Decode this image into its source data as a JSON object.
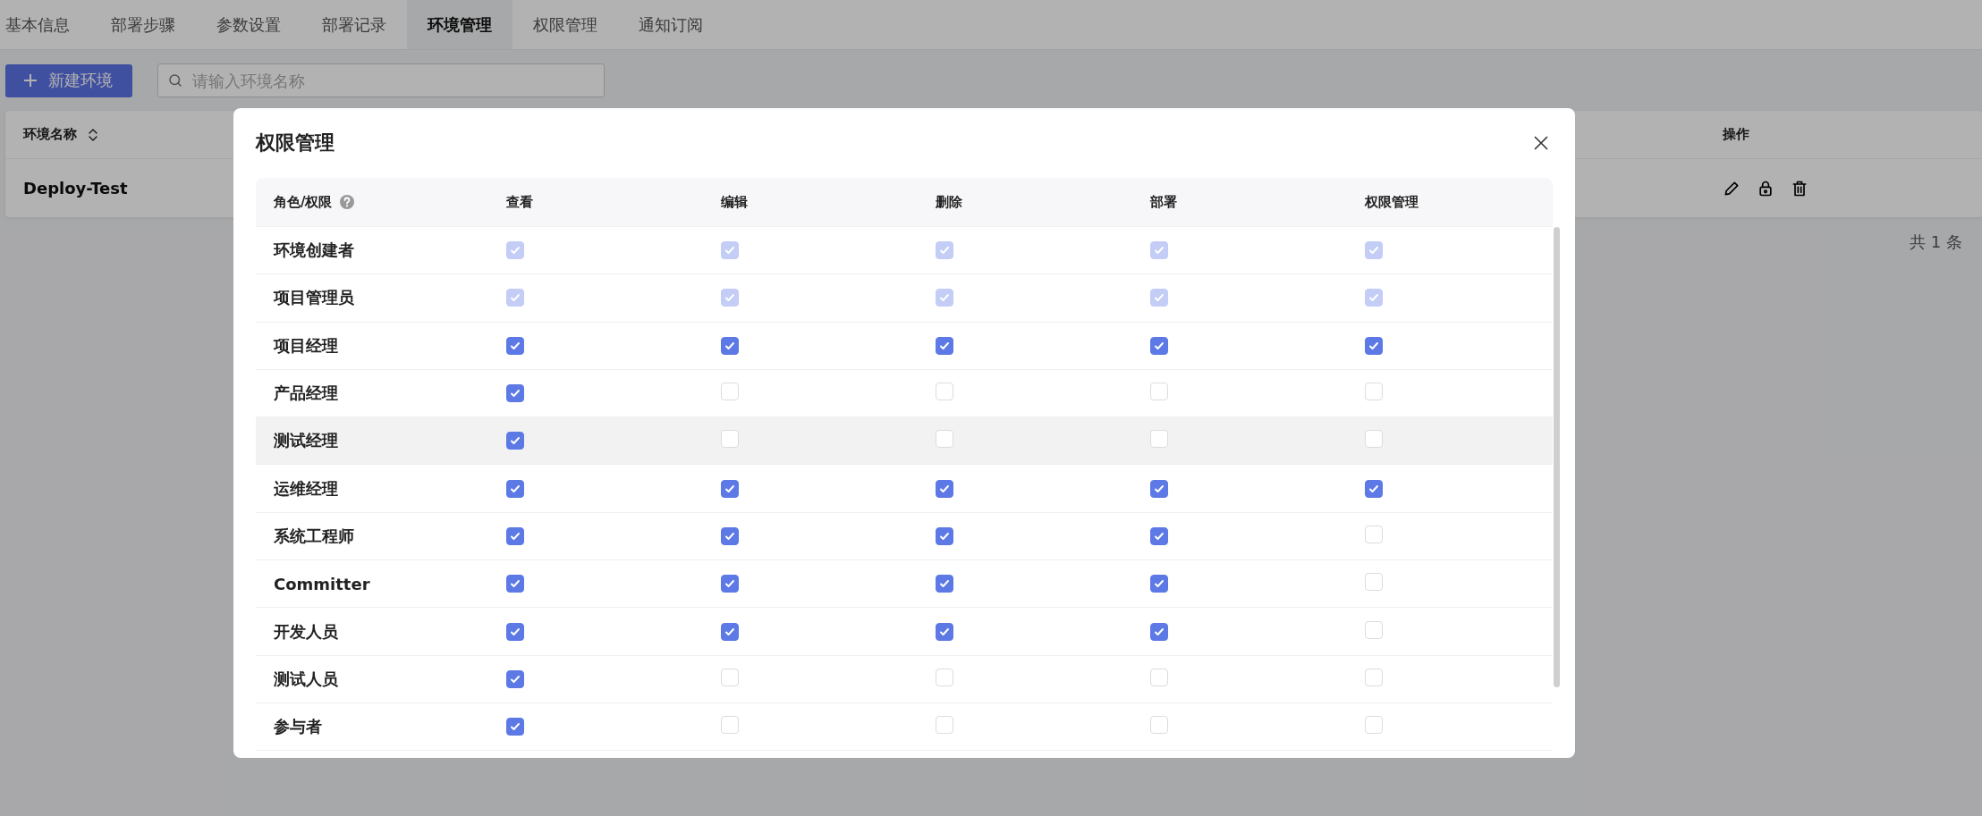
{
  "tabs": [
    {
      "label": "基本信息",
      "selected": false
    },
    {
      "label": "部署步骤",
      "selected": false
    },
    {
      "label": "参数设置",
      "selected": false
    },
    {
      "label": "部署记录",
      "selected": false
    },
    {
      "label": "环境管理",
      "selected": true
    },
    {
      "label": "权限管理",
      "selected": false
    },
    {
      "label": "通知订阅",
      "selected": false
    }
  ],
  "toolbar": {
    "new_button": "新建环境",
    "search": {
      "placeholder": "请输入环境名称"
    }
  },
  "table": {
    "columns": [
      {
        "label": "环境名称",
        "sortable": true
      },
      {
        "label": "操作",
        "sortable": false
      }
    ],
    "rows": [
      {
        "name": "Deploy-Test"
      }
    ]
  },
  "pagination": {
    "total": "共 1 条"
  },
  "dialog": {
    "title": "权限管理",
    "columns": [
      "角色/权限",
      "查看",
      "编辑",
      "删除",
      "部署",
      "权限管理"
    ],
    "rows": [
      {
        "role": "环境创建者",
        "disabled": true,
        "highlighted": false,
        "checks": [
          true,
          true,
          true,
          true,
          true
        ]
      },
      {
        "role": "项目管理员",
        "disabled": true,
        "highlighted": false,
        "checks": [
          true,
          true,
          true,
          true,
          true
        ]
      },
      {
        "role": "项目经理",
        "disabled": false,
        "highlighted": false,
        "checks": [
          true,
          true,
          true,
          true,
          true
        ]
      },
      {
        "role": "产品经理",
        "disabled": false,
        "highlighted": false,
        "checks": [
          true,
          false,
          false,
          false,
          false
        ]
      },
      {
        "role": "测试经理",
        "disabled": false,
        "highlighted": true,
        "checks": [
          true,
          false,
          false,
          false,
          false
        ]
      },
      {
        "role": "运维经理",
        "disabled": false,
        "highlighted": false,
        "checks": [
          true,
          true,
          true,
          true,
          true
        ]
      },
      {
        "role": "系统工程师",
        "disabled": false,
        "highlighted": false,
        "checks": [
          true,
          true,
          true,
          true,
          false
        ]
      },
      {
        "role": "Committer",
        "disabled": false,
        "highlighted": false,
        "checks": [
          true,
          true,
          true,
          true,
          false
        ]
      },
      {
        "role": "开发人员",
        "disabled": false,
        "highlighted": false,
        "checks": [
          true,
          true,
          true,
          true,
          false
        ]
      },
      {
        "role": "测试人员",
        "disabled": false,
        "highlighted": false,
        "checks": [
          true,
          false,
          false,
          false,
          false
        ]
      },
      {
        "role": "参与者",
        "disabled": false,
        "highlighted": false,
        "checks": [
          true,
          false,
          false,
          false,
          false
        ]
      }
    ]
  }
}
